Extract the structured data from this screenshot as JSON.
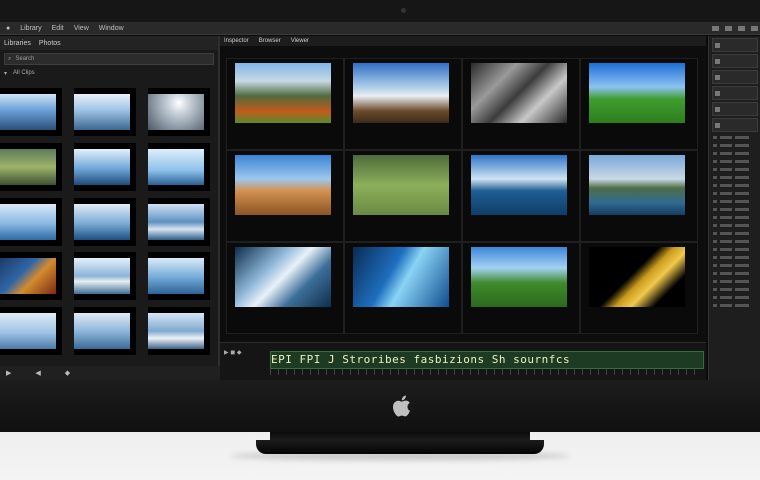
{
  "menubar": {
    "items": [
      "Library",
      "Edit",
      "View",
      "Window"
    ]
  },
  "left_panel": {
    "tabs": [
      "Libraries",
      "Photos"
    ],
    "search_placeholder": "Search",
    "filter_label": "All Clips",
    "thumbs": [
      {
        "caption": ""
      },
      {
        "caption": ""
      },
      {
        "caption": ""
      },
      {
        "caption": ""
      },
      {
        "caption": ""
      },
      {
        "caption": ""
      },
      {
        "caption": ""
      },
      {
        "caption": ""
      },
      {
        "caption": ""
      },
      {
        "caption": ""
      },
      {
        "caption": ""
      },
      {
        "caption": ""
      },
      {
        "caption": ""
      },
      {
        "caption": ""
      },
      {
        "caption": ""
      }
    ],
    "footer": [
      "▶",
      "◀",
      "◆"
    ]
  },
  "main": {
    "tabs": [
      "Inspector",
      "Browser",
      "Viewer"
    ],
    "cells": [
      {
        "caption": "",
        "sub": ""
      },
      {
        "caption": "",
        "sub": ""
      },
      {
        "caption": "",
        "sub": ""
      },
      {
        "caption": "",
        "sub": ""
      },
      {
        "caption": "",
        "sub": ""
      },
      {
        "caption": "",
        "sub": ""
      },
      {
        "caption": "",
        "sub": ""
      },
      {
        "caption": "",
        "sub": ""
      },
      {
        "caption": "",
        "sub": ""
      },
      {
        "caption": "",
        "sub": ""
      },
      {
        "caption": "",
        "sub": ""
      },
      {
        "caption": "",
        "sub": ""
      }
    ],
    "timeline_text": "EPI FPI J Stroribes fasbizions Sh sournfcs"
  },
  "colors": {
    "accent_green": "#3b6a3f",
    "bezel": "#161616"
  }
}
